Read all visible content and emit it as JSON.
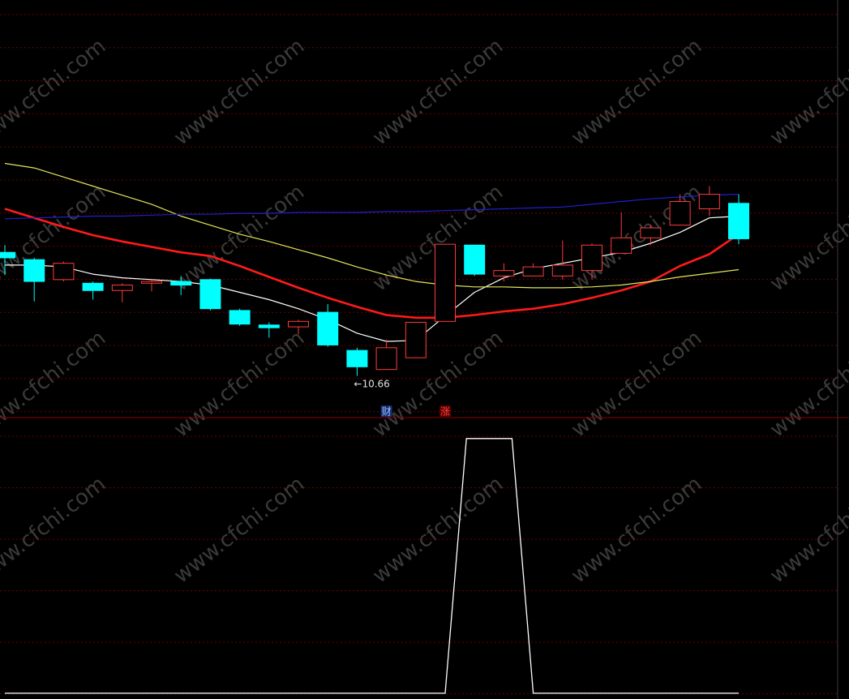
{
  "watermark": "www.cfchi.com",
  "colors": {
    "background": "#000000",
    "grid": "#6e0000",
    "up": "#ff3b3b",
    "down": "#00ffff",
    "ma_white": "#ffffff",
    "ma_red": "#ff1a1a",
    "ma_yellow": "#e6e65a",
    "ma_blue": "#1f1fd0",
    "divider": "#8b0000",
    "badge_fill": "#1a2a6e"
  },
  "chart_data": [
    {
      "type": "candlestick",
      "title": "",
      "candles": [
        {
          "open": 12.02,
          "close": 11.96,
          "high": 12.1,
          "low": 11.77
        },
        {
          "open": 11.94,
          "close": 11.7,
          "high": 11.96,
          "low": 11.48
        },
        {
          "open": 11.72,
          "close": 11.9,
          "high": 11.92,
          "low": 11.7
        },
        {
          "open": 11.68,
          "close": 11.6,
          "high": 11.7,
          "low": 11.5
        },
        {
          "open": 11.6,
          "close": 11.66,
          "high": 11.68,
          "low": 11.47
        },
        {
          "open": 11.68,
          "close": 11.7,
          "high": 11.72,
          "low": 11.59
        },
        {
          "open": 11.7,
          "close": 11.66,
          "high": 11.76,
          "low": 11.55
        },
        {
          "open": 11.72,
          "close": 11.4,
          "high": 11.73,
          "low": 11.38
        },
        {
          "open": 11.38,
          "close": 11.23,
          "high": 11.4,
          "low": 11.21
        },
        {
          "open": 11.22,
          "close": 11.19,
          "high": 11.25,
          "low": 11.08
        },
        {
          "open": 11.2,
          "close": 11.26,
          "high": 11.28,
          "low": 11.12
        },
        {
          "open": 11.36,
          "close": 11.0,
          "high": 11.45,
          "low": 10.98
        },
        {
          "open": 10.94,
          "close": 10.76,
          "high": 10.97,
          "low": 10.66
        },
        {
          "open": 10.73,
          "close": 10.97,
          "high": 11.06,
          "low": 10.73
        },
        {
          "open": 10.86,
          "close": 11.25,
          "high": 11.25,
          "low": 10.86
        },
        {
          "open": 11.26,
          "close": 12.11,
          "high": 12.11,
          "low": 11.26
        },
        {
          "open": 12.1,
          "close": 11.78,
          "high": 12.1,
          "low": 11.76
        },
        {
          "open": 11.76,
          "close": 11.82,
          "high": 11.9,
          "low": 11.7
        },
        {
          "open": 11.76,
          "close": 11.86,
          "high": 11.9,
          "low": 11.76
        },
        {
          "open": 11.76,
          "close": 11.88,
          "high": 12.15,
          "low": 11.72
        },
        {
          "open": 11.82,
          "close": 12.1,
          "high": 12.12,
          "low": 11.72
        },
        {
          "open": 12.01,
          "close": 12.18,
          "high": 12.46,
          "low": 12.01
        },
        {
          "open": 12.18,
          "close": 12.29,
          "high": 12.32,
          "low": 12.1
        },
        {
          "open": 12.32,
          "close": 12.58,
          "high": 12.66,
          "low": 12.32
        },
        {
          "open": 12.5,
          "close": 12.66,
          "high": 12.75,
          "low": 12.42
        },
        {
          "open": 12.56,
          "close": 12.17,
          "high": 12.66,
          "low": 12.11
        }
      ],
      "ma": [
        {
          "color_key": "ma_white",
          "values": [
            11.88,
            11.88,
            11.86,
            11.78,
            11.74,
            11.72,
            11.7,
            11.66,
            11.58,
            11.5,
            11.4,
            11.28,
            11.13,
            11.04,
            11.05,
            11.32,
            11.58,
            11.74,
            11.84,
            11.9,
            11.96,
            12.02,
            12.12,
            12.24,
            12.4,
            12.42
          ]
        },
        {
          "color_key": "ma_red",
          "values": [
            12.5,
            12.4,
            12.3,
            12.21,
            12.14,
            12.08,
            12.02,
            11.98,
            11.87,
            11.75,
            11.63,
            11.52,
            11.42,
            11.33,
            11.3,
            11.3,
            11.33,
            11.37,
            11.4,
            11.45,
            11.52,
            11.6,
            11.7,
            11.87,
            12.0,
            12.22
          ]
        },
        {
          "color_key": "ma_yellow",
          "values": [
            13.0,
            12.95,
            12.85,
            12.75,
            12.65,
            12.55,
            12.42,
            12.32,
            12.22,
            12.14,
            12.05,
            11.96,
            11.86,
            11.77,
            11.7,
            11.66,
            11.64,
            11.64,
            11.63,
            11.63,
            11.64,
            11.66,
            11.7,
            11.75,
            11.79,
            11.83
          ]
        },
        {
          "color_key": "ma_blue",
          "values": [
            12.39,
            12.4,
            12.41,
            12.42,
            12.42,
            12.43,
            12.44,
            12.44,
            12.45,
            12.45,
            12.46,
            12.46,
            12.46,
            12.47,
            12.47,
            12.48,
            12.49,
            12.5,
            12.51,
            12.52,
            12.55,
            12.58,
            12.61,
            12.63,
            12.65,
            12.66
          ]
        }
      ],
      "ylim": [
        10.2,
        14.8
      ],
      "grid": true,
      "annotations": [
        {
          "index": 12,
          "text": "←10.66",
          "kind": "low"
        },
        {
          "index": 13,
          "text": "财",
          "kind": "badge-blue"
        },
        {
          "index": 15,
          "text": "涨",
          "kind": "badge-red"
        }
      ]
    },
    {
      "type": "line",
      "title": "",
      "values": [
        0,
        0,
        0,
        0,
        0,
        0,
        0,
        0,
        0,
        0,
        0,
        0,
        0,
        0,
        0,
        0,
        1,
        1,
        0,
        0,
        0,
        0,
        0,
        0,
        0,
        0
      ],
      "ylim": [
        -0.01,
        1.06
      ],
      "grid": true,
      "color_key": "ma_white"
    }
  ]
}
